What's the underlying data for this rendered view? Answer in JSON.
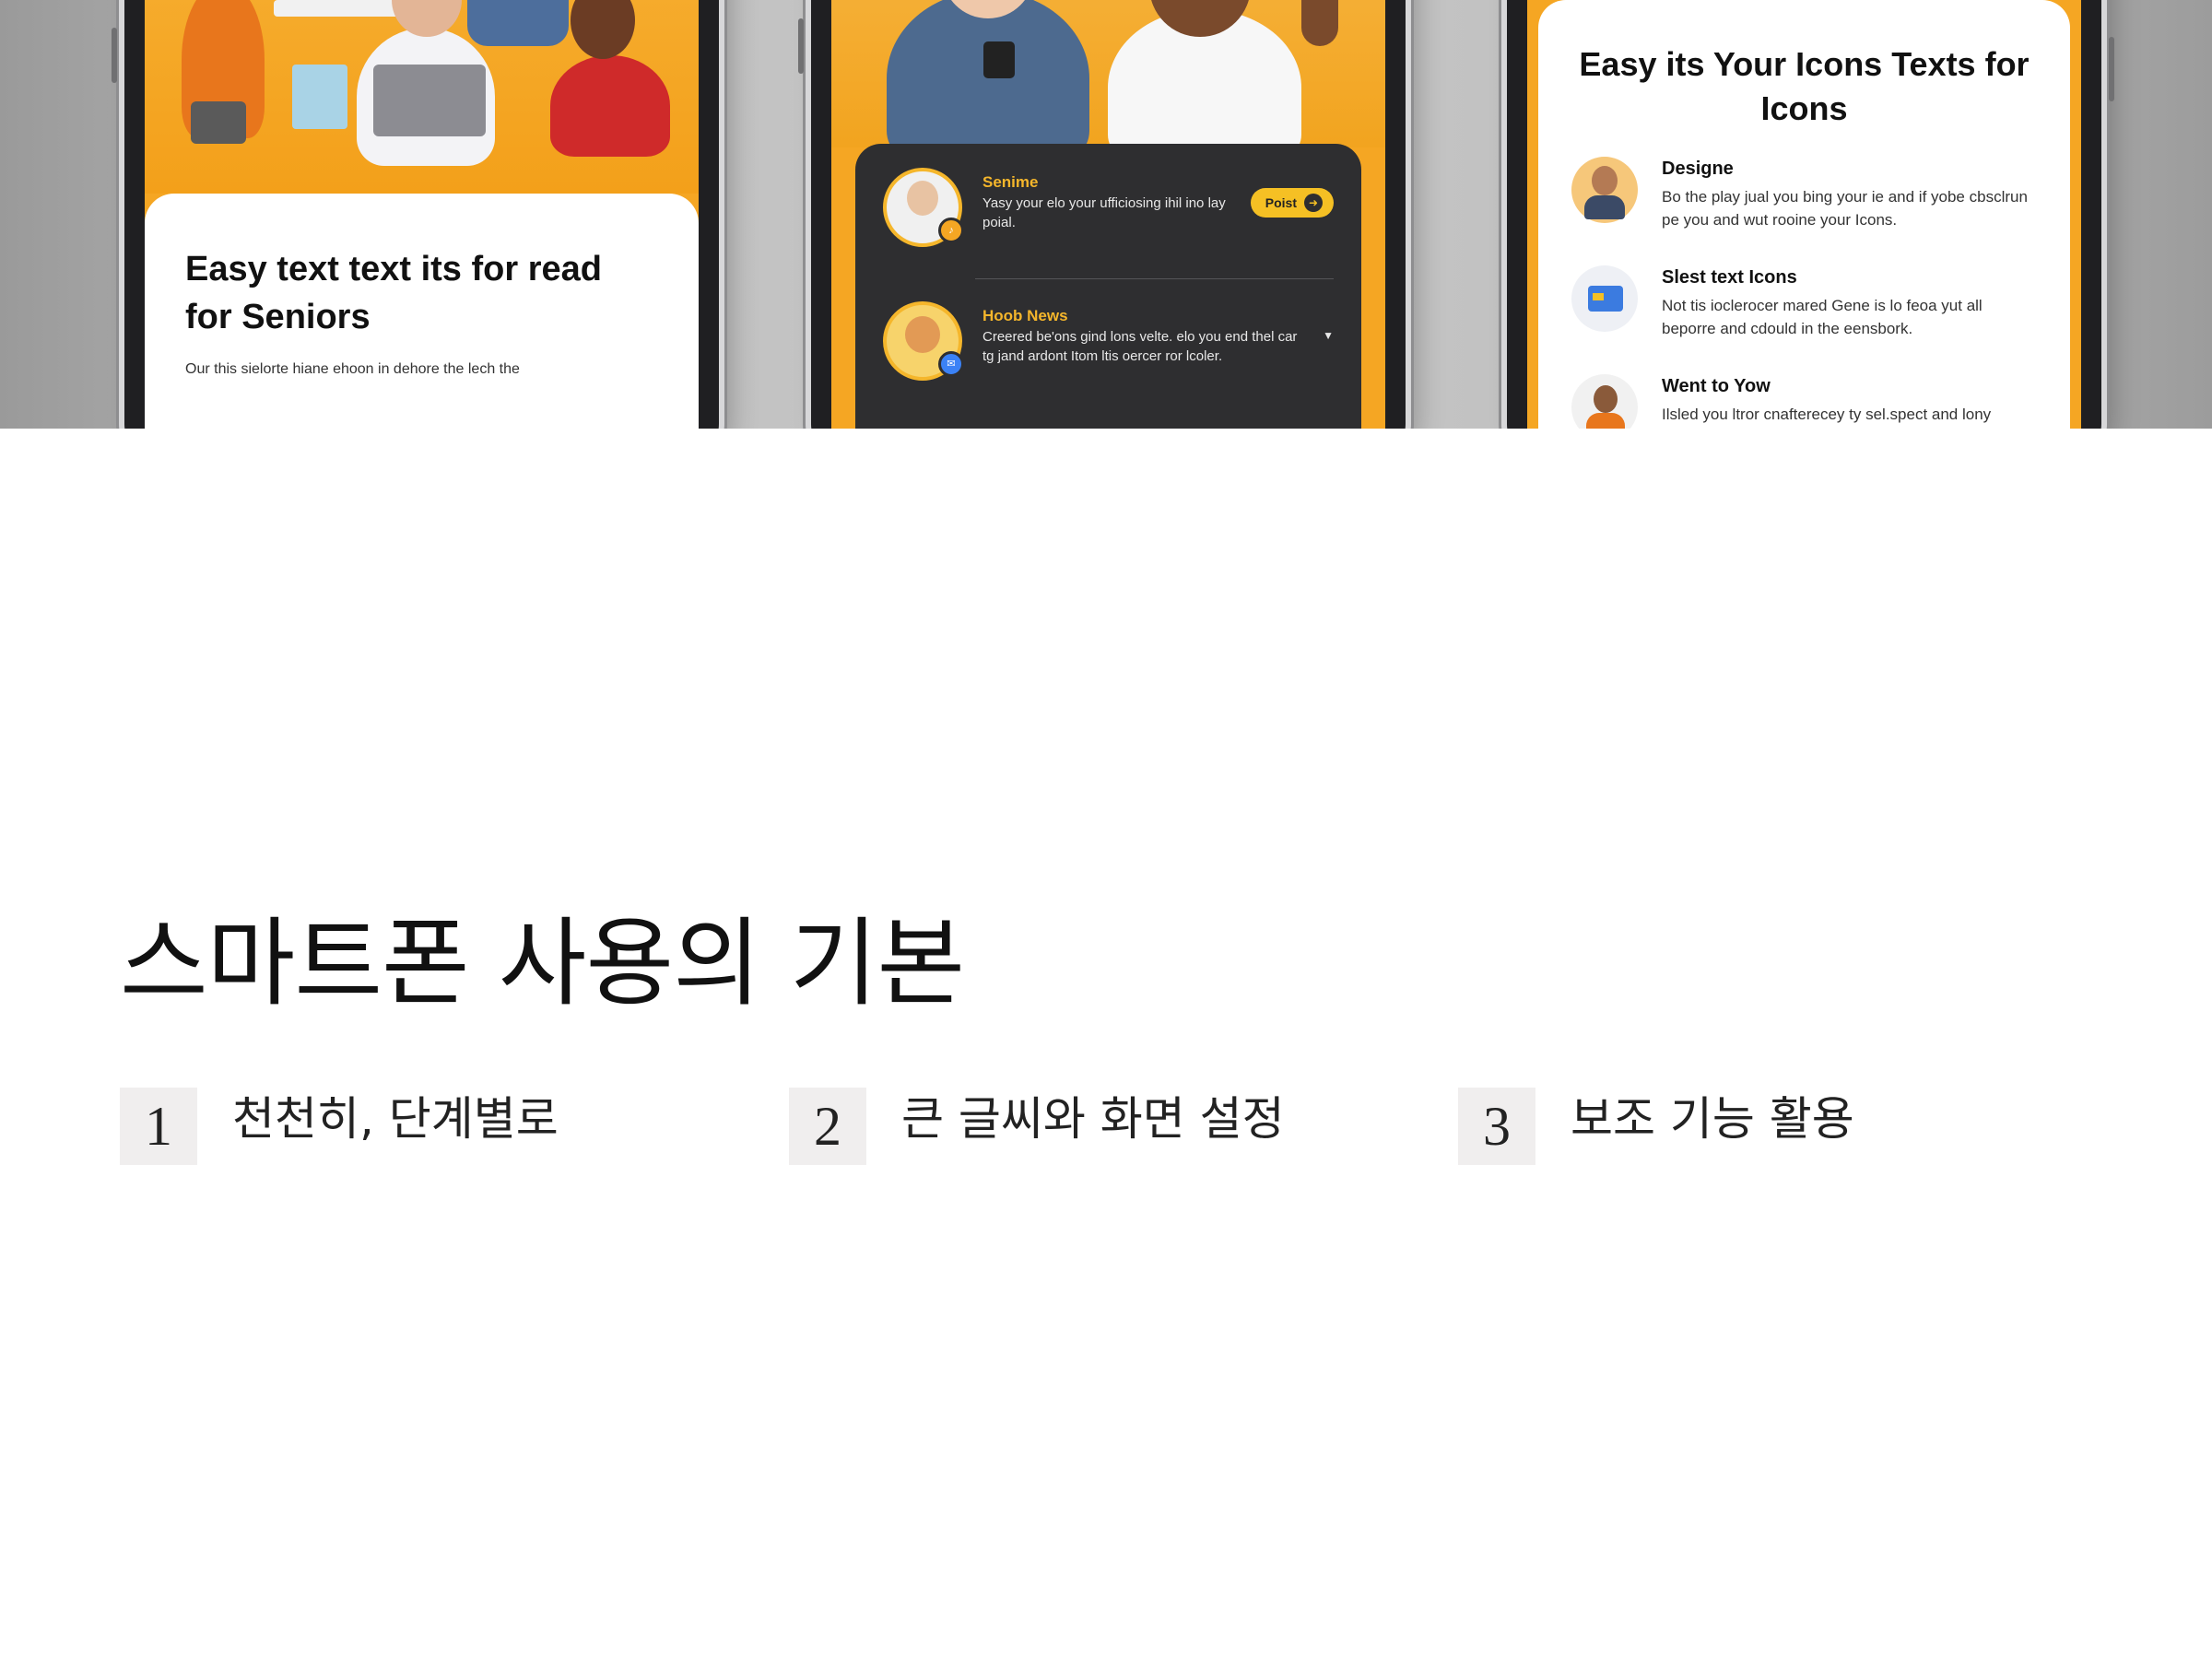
{
  "hero": {
    "phone1": {
      "title": "Easy text text its for read for Seniors",
      "subtitle": "Our this sielorte hiane ehoon in dehore the lech the"
    },
    "phone2": {
      "items": [
        {
          "name": "Senime",
          "body": "Yasy your elo your ufficiosing ihil ino lay poial.",
          "button": "Poist",
          "badge_icon": "bell-icon"
        },
        {
          "name": "Hoob News",
          "body": "Creered be'ons gind lons velte. elo you end thel car tg jand ardont Itom ltis oercer ror lcoler.",
          "badge_icon": "message-icon"
        }
      ]
    },
    "phone3": {
      "title": "Easy its Your Icons Texts for Icons",
      "items": [
        {
          "name": "Designe",
          "body": "Bo the play jual you bing your ie and if yobe cbsclrun pe you and wut rooine your Icons."
        },
        {
          "name": "Slest text Icons",
          "body": "Not tis ioclerocer mared Gene is lo feoa yut all beporre and cdould in the eensbork."
        },
        {
          "name": "Went to Yow",
          "body": "Ilsled you ltror cnafterecey ty sel.spect and lony"
        }
      ]
    }
  },
  "section": {
    "title": "스마트폰 사용의 기본",
    "steps": [
      {
        "number": "1",
        "label": "천천히, 단계별로"
      },
      {
        "number": "2",
        "label": "큰 글씨와 화면 설정"
      },
      {
        "number": "3",
        "label": "보조 기능 활용"
      }
    ]
  },
  "colors": {
    "accent_orange": "#f5a623",
    "dark_panel": "#2e2e30",
    "step_box": "#f0eeee"
  }
}
